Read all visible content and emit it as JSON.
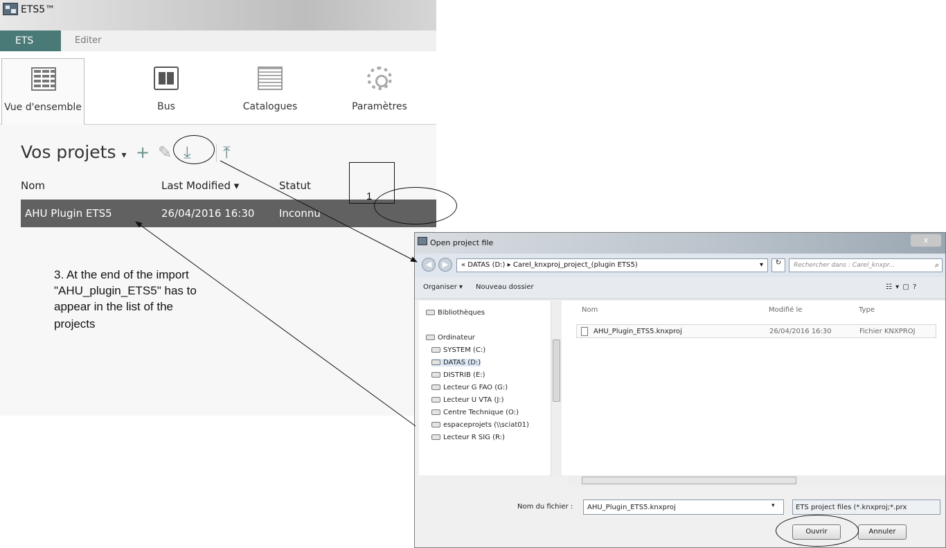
{
  "app": {
    "title": "ETS5™",
    "menu": [
      "ETS",
      "Editer"
    ]
  },
  "ribbon_tabs": [
    {
      "label": "Vue d'ensemble",
      "icon": "overview-grid-icon",
      "active": true
    },
    {
      "label": "Bus",
      "icon": "bus-icon",
      "active": false
    },
    {
      "label": "Catalogues",
      "icon": "catalog-book-icon",
      "active": false
    },
    {
      "label": "Paramètres",
      "icon": "gear-icon",
      "active": false
    }
  ],
  "projects": {
    "title": "Vos projets",
    "dropdown": "▾",
    "add": "+",
    "edit": "✎",
    "import": "⤓",
    "export": "⤒",
    "columns": [
      "Nom",
      "Last Modified ▾",
      "Statut"
    ],
    "rows": [
      {
        "name": "AHU Plugin ETS5",
        "modified": "26/04/2016 16:30",
        "status": "Inconnu"
      }
    ]
  },
  "annotations": {
    "step1": "1",
    "step3_lines": [
      "3. At the end of the import",
      "\"AHU_plugin_ETS5\" has to",
      "appear in the list of the",
      "projects"
    ]
  },
  "dialog": {
    "title": "Open project file",
    "close": "x",
    "back": "◀",
    "forward": "▶",
    "path": "« DATAS (D:) ▸ Carel_knxproj_project_(plugin ETS5)",
    "path_dropdown": "▾",
    "refresh": "↻",
    "search_placeholder": "Rechercher dans : Carel_knxpr...",
    "search_icon": "⌕",
    "organiser": "Organiser ▾",
    "new_folder": "Nouveau dossier",
    "view_icons": "☷ ▾   ▢   ?",
    "nav_items": [
      "Bibliothèques",
      "Ordinateur",
      "SYSTEM (C:)",
      "DATAS (D:)",
      "DISTRIB (E:)",
      "Lecteur G FAO (G:)",
      "Lecteur U VTA (J:)",
      "Centre Technique (O:)",
      "espaceprojets (\\\\sciat01)",
      "Lecteur R SIG (R:)"
    ],
    "file_columns": [
      "Nom",
      "Modifié le",
      "Type"
    ],
    "files": [
      {
        "name": "AHU_Plugin_ETS5.knxproj",
        "modified": "26/04/2016 16:30",
        "type": "Fichier KNXPROJ"
      }
    ],
    "filename_label": "Nom du fichier :",
    "filename_value": "AHU_Plugin_ETS5.knxproj",
    "filetype": "ETS project files (*.knxproj;*.prx",
    "open_button": "Ouvrir",
    "cancel_button": "Annuler"
  }
}
